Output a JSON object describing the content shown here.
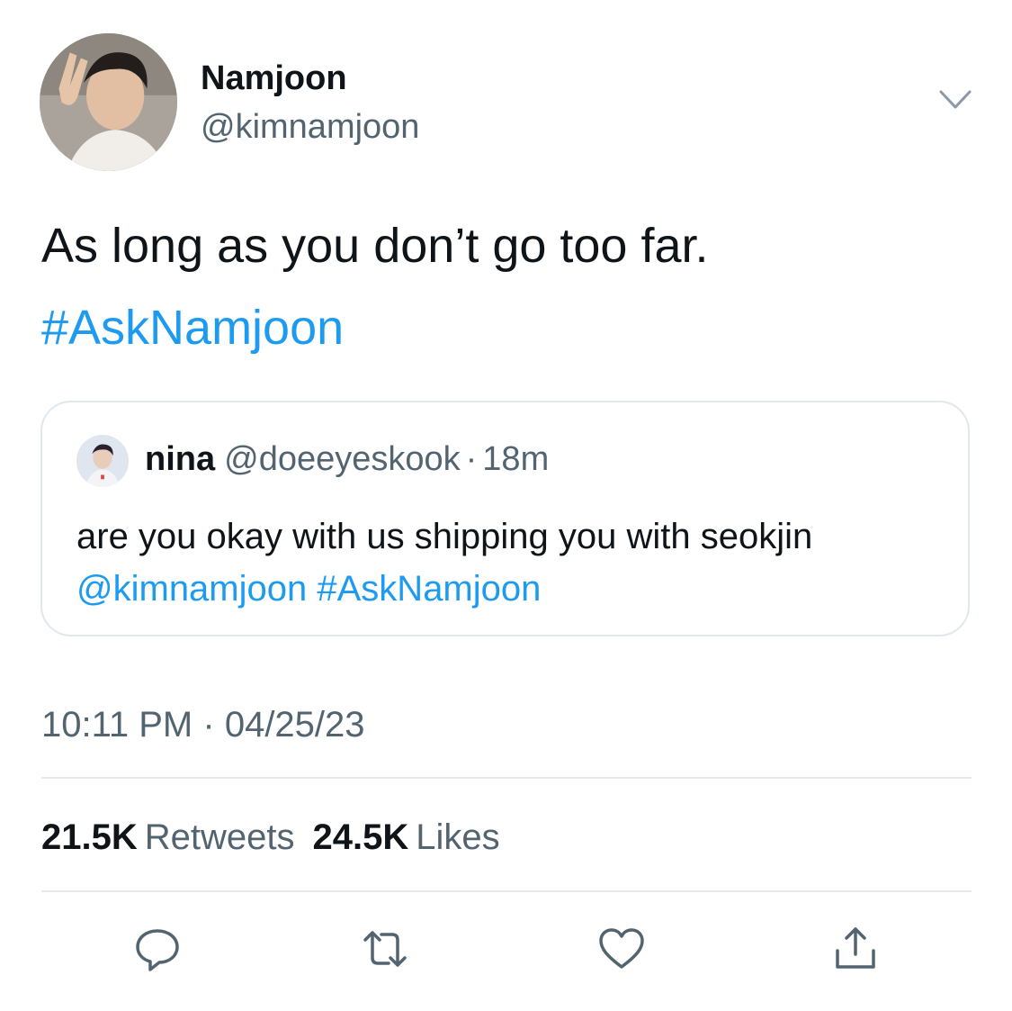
{
  "author": {
    "display_name": "Namjoon",
    "handle": "@kimnamjoon"
  },
  "tweet": {
    "text": "As long as you don’t go too far.",
    "hashtag": "#AskNamjoon"
  },
  "quoted_tweet": {
    "name": "nina",
    "handle": "@doeeyeskook",
    "separator": "·",
    "time": "18m",
    "text": "are you okay with us shipping you with seokjin",
    "mention": "@kimnamjoon",
    "hashtag": "#AskNamjoon"
  },
  "meta": {
    "time": "10:11 PM",
    "separator": "·",
    "date": "04/25/23"
  },
  "stats": {
    "retweets_count": "21.5K",
    "retweets_label": "Retweets",
    "likes_count": "24.5K",
    "likes_label": "Likes"
  },
  "actions": {
    "icons": [
      "reply-icon",
      "retweet-icon",
      "like-icon",
      "share-icon"
    ]
  },
  "colors": {
    "link": "#1d9bf0",
    "secondary_text": "#536471",
    "primary_text": "#0f1419",
    "divider": "#e7e9ea",
    "icon": "#536471"
  }
}
